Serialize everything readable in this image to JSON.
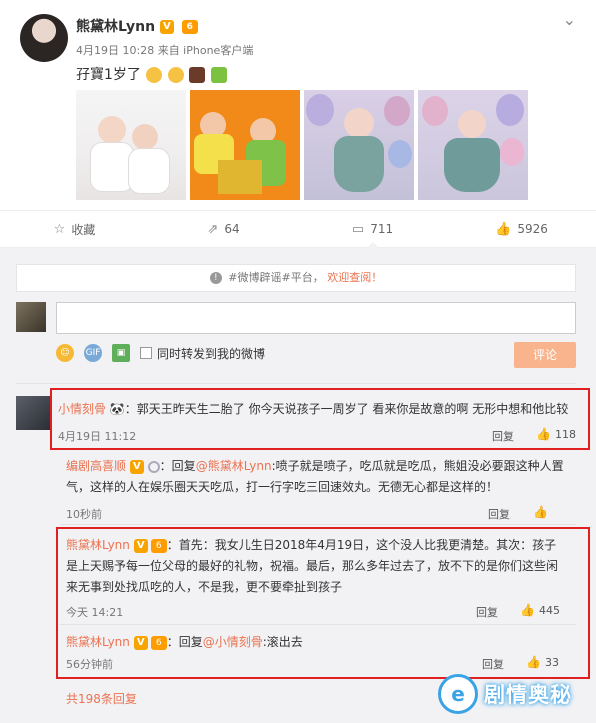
{
  "post": {
    "author": "熊黛林Lynn",
    "verified_badge": "V",
    "level_badge": "6",
    "meta": "4月19日 10:28 来自 iPhone客户端",
    "text": "孖寶1岁了",
    "emoji_icons": [
      "grin-sweat-emoji",
      "grin-sweat-emoji",
      "cake-emoji",
      "gift-emoji"
    ],
    "photos": [
      "twin-babies-white-photo",
      "twin-babies-orange-photo",
      "baby-balloons-photo-1",
      "baby-balloons-photo-2"
    ]
  },
  "actions": {
    "favorite_label": "收藏",
    "forward_count": "64",
    "comment_count": "711",
    "like_count": "5926"
  },
  "rumor_bar": {
    "text": "#微博辟谣#平台，",
    "link": "欢迎查阅！"
  },
  "composer": {
    "placeholder": "",
    "forward_label": "同时转发到我的微博",
    "submit_label": "评论"
  },
  "comments": [
    {
      "user": "小情刻骨",
      "badge": "🐼",
      "text": "：郭天王昨天生二胎了 你今天说孩子一周岁了 看来你是故意的啊 无形中想和他比较",
      "time": "4月19日 11:12",
      "reply_label": "回复",
      "likes": "118",
      "replies": [
        {
          "user": "编剧高喜顺",
          "badge": "V",
          "text_prefix": "：回复",
          "mention": "@熊黛林Lynn",
          "text": ":喷子就是喷子，吃瓜就是吃瓜，熊姐没必要跟这种人置气，这样的人在娱乐圈天天吃瓜，打一行字吃三回速效丸。无德无心都是这样的！",
          "time": "10秒前",
          "reply_label": "回复",
          "likes": ""
        },
        {
          "user": "熊黛林Lynn",
          "badge": "V",
          "level": "6",
          "text": "：首先：我女儿生日2018年4月19日，这个没人比我更清楚。其次：孩子是上天赐予每一位父母的最好的礼物，祝福。最后，那么多年过去了，放不下的是你们这些闲来无事到处找瓜吃的人，不是我，更不要牵扯到孩子",
          "time": "今天 14:21",
          "reply_label": "回复",
          "likes": "445"
        },
        {
          "user": "熊黛林Lynn",
          "badge": "V",
          "level": "6",
          "text_prefix": "：回复",
          "mention": "@小情刻骨",
          "text": ":滚出去",
          "time": "56分钟前",
          "reply_label": "回复",
          "likes": "33"
        }
      ]
    }
  ],
  "more_replies": "共198条回复",
  "watermark": {
    "text": "剧情奥秘",
    "logo": "e"
  },
  "colors": {
    "accent": "#eb7350",
    "highlight_border": "#e02020",
    "watermark": "#3aa3e6"
  }
}
